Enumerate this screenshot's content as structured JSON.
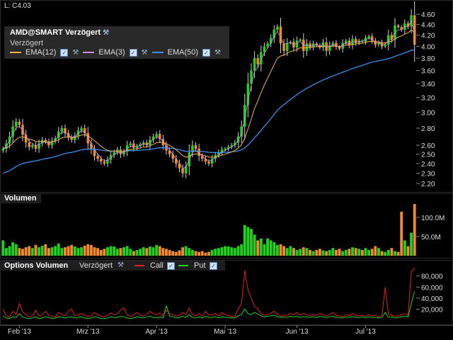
{
  "last_price": "L: C4.03",
  "legend": {
    "title": "AMD@SMART Verzögert",
    "subtitle": "Verzögert",
    "items": [
      {
        "label": "EMA(12)",
        "color": "#f0b050"
      },
      {
        "label": "EMA(3)",
        "color": "#c890e0"
      },
      {
        "label": "EMA(50)",
        "color": "#3a8de8"
      }
    ]
  },
  "volume_panel": {
    "title": "Volumen"
  },
  "options_panel": {
    "title": "Options Volumen",
    "delayed": "Verzögert",
    "call_label": "Call",
    "put_label": "Put"
  },
  "colors": {
    "up": "#22d022",
    "down": "#f08a30",
    "call": "#e02020",
    "put": "#20d020",
    "ema12": "#f0b050",
    "ema3": "#c890e0",
    "ema50": "#3a8de8"
  },
  "chart_data": [
    {
      "type": "candlestick",
      "title": "AMD@SMART Verzögert",
      "y_ticks": [
        "4.60",
        "4.40",
        "4.20",
        "4.00",
        "3.80",
        "3.60",
        "3.40",
        "3.20",
        "3.00",
        "2.80",
        "2.60",
        "2.50",
        "2.40",
        "2.30",
        "2.20"
      ],
      "ylim": [
        2.18,
        4.66
      ],
      "x_ticks": [
        "Feb '13",
        "Mrz '13",
        "Apr '13",
        "Mai '13",
        "Jun '13",
        "Jul '13"
      ],
      "closes": [
        2.56,
        2.62,
        2.7,
        2.82,
        2.88,
        2.84,
        2.72,
        2.63,
        2.58,
        2.6,
        2.56,
        2.62,
        2.66,
        2.64,
        2.6,
        2.65,
        2.68,
        2.76,
        2.8,
        2.74,
        2.69,
        2.66,
        2.71,
        2.77,
        2.8,
        2.74,
        2.62,
        2.55,
        2.48,
        2.45,
        2.42,
        2.4,
        2.44,
        2.49,
        2.52,
        2.55,
        2.5,
        2.53,
        2.6,
        2.62,
        2.57,
        2.59,
        2.61,
        2.63,
        2.6,
        2.66,
        2.7,
        2.73,
        2.67,
        2.6,
        2.54,
        2.5,
        2.45,
        2.4,
        2.35,
        2.3,
        2.37,
        2.52,
        2.6,
        2.56,
        2.48,
        2.45,
        2.42,
        2.4,
        2.45,
        2.49,
        2.52,
        2.55,
        2.56,
        2.58,
        2.6,
        2.63,
        2.7,
        2.82,
        3.1,
        3.4,
        3.6,
        3.8,
        3.7,
        3.9,
        4.0,
        4.05,
        4.15,
        4.3,
        4.36,
        4.05,
        3.92,
        4.06,
        4.08,
        3.98,
        4.1,
        4.12,
        3.92,
        4.05,
        3.98,
        4.05,
        4.02,
        3.98,
        4.07,
        3.92,
        4.02,
        4.06,
        3.99,
        3.96,
        4.06,
        4.1,
        4.02,
        4.13,
        4.06,
        4.1,
        4.08,
        4.15,
        4.18,
        4.1,
        4.03,
        4.07,
        4.0,
        4.03,
        4.2,
        4.12,
        4.38,
        4.35,
        4.3,
        4.42,
        4.36,
        4.58,
        4.03
      ],
      "series": [
        {
          "name": "EMA(12)",
          "type": "line"
        },
        {
          "name": "EMA(3)",
          "type": "line"
        },
        {
          "name": "EMA(50)",
          "type": "line"
        }
      ]
    },
    {
      "type": "bar",
      "title": "Volumen",
      "y_ticks": [
        "100.0M",
        "50.0M"
      ],
      "ylim": [
        0,
        135
      ],
      "values": [
        40,
        20,
        25,
        35,
        30,
        20,
        18,
        22,
        25,
        20,
        28,
        22,
        26,
        30,
        20,
        22,
        25,
        32,
        20,
        22,
        25,
        28,
        24,
        20,
        22,
        26,
        30,
        28,
        22,
        20,
        15,
        18,
        22,
        25,
        24,
        18,
        20,
        22,
        25,
        18,
        12,
        15,
        18,
        22,
        20,
        24,
        22,
        28,
        25,
        20,
        18,
        15,
        12,
        10,
        14,
        22,
        25,
        20,
        15,
        12,
        10,
        12,
        8,
        10,
        15,
        18,
        20,
        22,
        25,
        24,
        22,
        20,
        25,
        30,
        80,
        75,
        70,
        55,
        40,
        45,
        30,
        45,
        40,
        35,
        28,
        30,
        25,
        20,
        25,
        20,
        15,
        18,
        22,
        20,
        15,
        12,
        15,
        18,
        14,
        12,
        15,
        20,
        15,
        18,
        12,
        15,
        18,
        22,
        20,
        18,
        15,
        20,
        15,
        18,
        25,
        20,
        12,
        10,
        15,
        20,
        12,
        10,
        115,
        40,
        25,
        60,
        135
      ]
    },
    {
      "type": "line",
      "title": "Options Volumen",
      "y_ticks": [
        "80,000",
        "60,000",
        "40,000",
        "20,000"
      ],
      "ylim": [
        0,
        95000
      ],
      "series": [
        {
          "name": "Call",
          "values": [
            20,
            8,
            6,
            16,
            10,
            30,
            15,
            10,
            6,
            8,
            18,
            7,
            10,
            16,
            9,
            7,
            6,
            14,
            10,
            8,
            16,
            20,
            8,
            10,
            12,
            9,
            7,
            8,
            14,
            10,
            7,
            6,
            9,
            13,
            10,
            12,
            18,
            22,
            10,
            6,
            10,
            14,
            9,
            7,
            11,
            16,
            12,
            10,
            13,
            8,
            18,
            12,
            10,
            7,
            9,
            14,
            10,
            22,
            10,
            8,
            12,
            7,
            16,
            9,
            10,
            12,
            8,
            14,
            10,
            9,
            6,
            7,
            20,
            30,
            90,
            55,
            40,
            25,
            20,
            12,
            9,
            10,
            13,
            16,
            10,
            7,
            9,
            9,
            12,
            10,
            14,
            9,
            12,
            10,
            8,
            10,
            9,
            12,
            10,
            8,
            10,
            14,
            9,
            8,
            6,
            10,
            8,
            12,
            9,
            8,
            9,
            7,
            10,
            8,
            9,
            6,
            8,
            60,
            10,
            9,
            7,
            8,
            10,
            12,
            9,
            88,
            95
          ]
        },
        {
          "name": "Put",
          "values": [
            8,
            4,
            3,
            6,
            5,
            12,
            6,
            4,
            3,
            4,
            6,
            3,
            4,
            6,
            5,
            3,
            4,
            6,
            5,
            4,
            5,
            6,
            4,
            5,
            6,
            4,
            3,
            4,
            6,
            5,
            3,
            3,
            4,
            6,
            5,
            5,
            7,
            6,
            4,
            3,
            4,
            6,
            5,
            4,
            6,
            7,
            5,
            4,
            6,
            4,
            26,
            8,
            6,
            4,
            5,
            7,
            5,
            10,
            5,
            4,
            6,
            4,
            7,
            5,
            5,
            6,
            4,
            6,
            5,
            5,
            4,
            4,
            8,
            10,
            20,
            12,
            10,
            14,
            11,
            8,
            6,
            7,
            8,
            9,
            6,
            5,
            6,
            5,
            7,
            6,
            7,
            5,
            6,
            6,
            5,
            6,
            5,
            7,
            6,
            5,
            6,
            7,
            5,
            5,
            4,
            6,
            5,
            7,
            5,
            5,
            6,
            4,
            6,
            5,
            5,
            4,
            5,
            14,
            5,
            6,
            4,
            5,
            6,
            7,
            6,
            30,
            52
          ]
        }
      ]
    }
  ]
}
